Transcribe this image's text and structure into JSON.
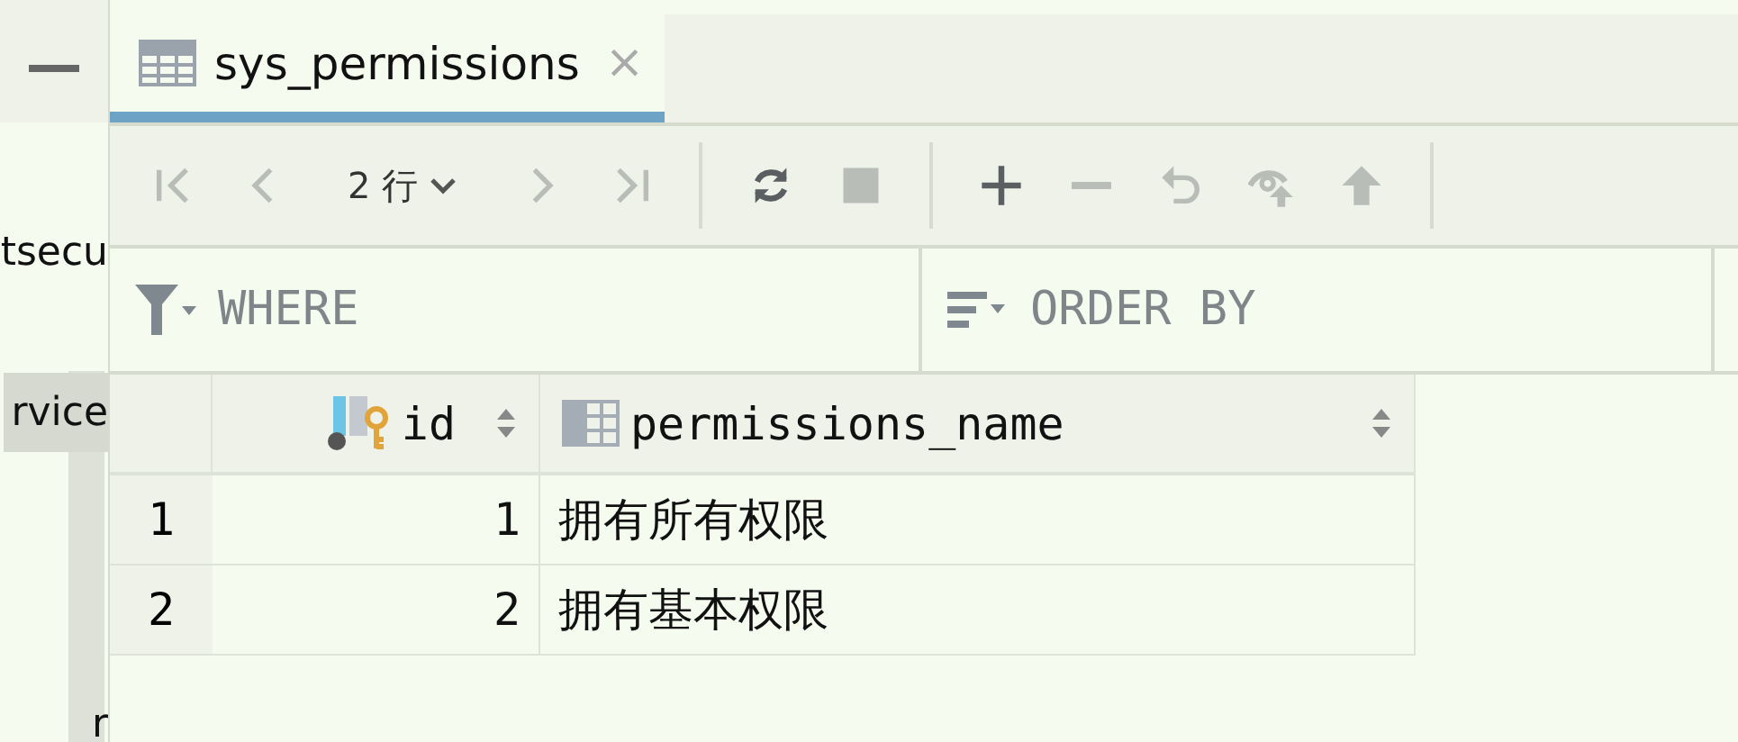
{
  "sidebar": {
    "items": [
      {
        "label": "tsecu",
        "selected": false
      },
      {
        "label": "rvice",
        "selected": true
      },
      {
        "label": "r",
        "selected": false
      }
    ]
  },
  "tab": {
    "title": "sys_permissions",
    "close": "×",
    "selected": true
  },
  "toolbar": {
    "nav": [
      {
        "kind": "first",
        "disabled": true
      },
      {
        "kind": "prev",
        "disabled": true
      }
    ],
    "row_count": "2 行",
    "nav_after": [
      {
        "kind": "next",
        "disabled": true
      },
      {
        "kind": "last",
        "disabled": true
      }
    ],
    "actions": [
      {
        "kind": "refresh",
        "disabled": false
      },
      {
        "kind": "stop",
        "disabled": true
      }
    ],
    "edit": [
      {
        "kind": "add",
        "disabled": false
      },
      {
        "kind": "remove",
        "disabled": true
      },
      {
        "kind": "revert",
        "disabled": true
      },
      {
        "kind": "preview",
        "disabled": true
      },
      {
        "kind": "submit",
        "disabled": true
      }
    ]
  },
  "filters": {
    "where": {
      "placeholder": "WHERE"
    },
    "order_by": {
      "placeholder": "ORDER BY"
    }
  },
  "table": {
    "columns": [
      {
        "name": "id",
        "kind": "key"
      },
      {
        "name": "permissions_name",
        "kind": "text"
      }
    ],
    "rows": [
      {
        "number": "1",
        "cells": [
          "1",
          "拥有所有权限"
        ]
      },
      {
        "number": "2",
        "cells": [
          "2",
          "拥有基本权限"
        ]
      }
    ]
  }
}
